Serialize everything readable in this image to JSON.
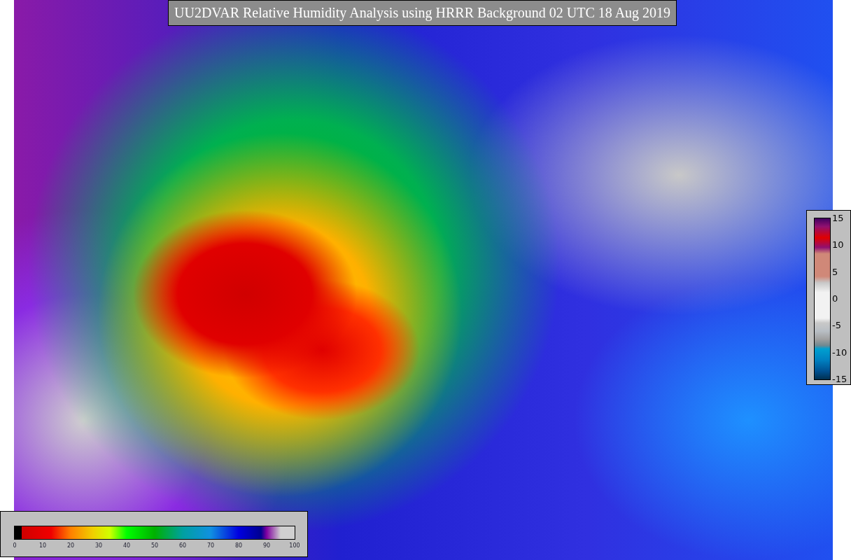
{
  "title": "UU2DVAR Relative Humidity Analysis using HRRR Background 02 UTC 18 Aug 2019",
  "humidity_colorbar": {
    "ticks": [
      "0",
      "10",
      "20",
      "30",
      "40",
      "50",
      "60",
      "70",
      "80",
      "90",
      "100"
    ]
  },
  "difference_colorbar": {
    "ticks": [
      "15",
      "10",
      "5",
      "0",
      "-5",
      "-10",
      "-15"
    ]
  }
}
